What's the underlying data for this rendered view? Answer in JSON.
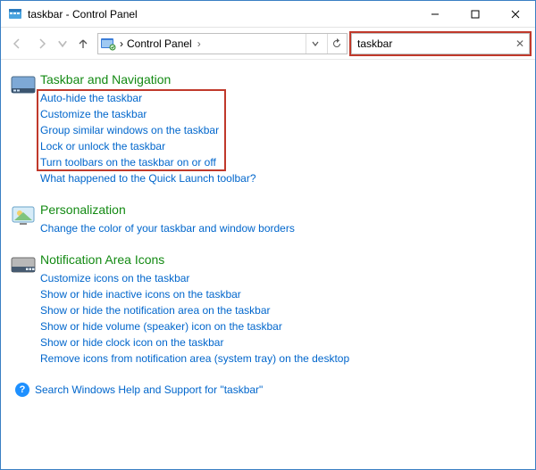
{
  "window": {
    "title": "taskbar - Control Panel"
  },
  "nav": {
    "breadcrumb_root": "Control Panel",
    "search_value": "taskbar"
  },
  "sections": {
    "taskbar_nav": {
      "title": "Taskbar and Navigation",
      "links": [
        "Auto-hide the taskbar",
        "Customize the taskbar",
        "Group similar windows on the taskbar",
        "Lock or unlock the taskbar",
        "Turn toolbars on the taskbar on or off",
        "What happened to the Quick Launch toolbar?"
      ]
    },
    "personalization": {
      "title": "Personalization",
      "links": [
        "Change the color of your taskbar and window borders"
      ]
    },
    "notification": {
      "title": "Notification Area Icons",
      "links": [
        "Customize icons on the taskbar",
        "Show or hide inactive icons on the taskbar",
        "Show or hide the notification area on the taskbar",
        "Show or hide volume (speaker) icon on the taskbar",
        "Show or hide clock icon on the taskbar",
        "Remove icons from notification area (system tray) on the desktop"
      ]
    }
  },
  "help_footer": "Search Windows Help and Support for \"taskbar\""
}
